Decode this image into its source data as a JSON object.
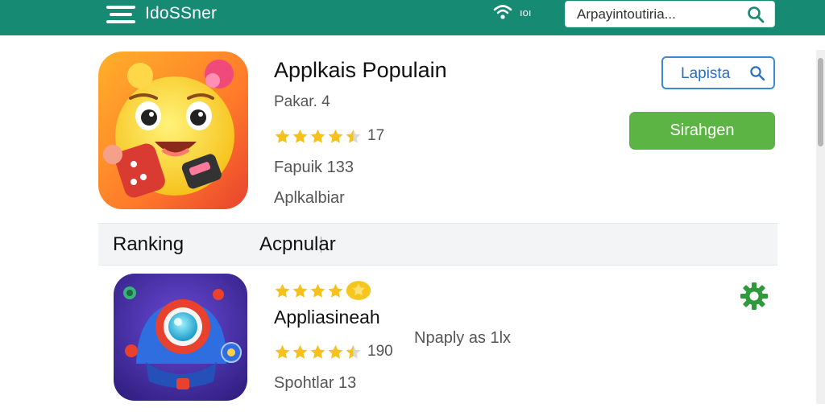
{
  "header": {
    "brand": "IdoSSner",
    "signal_text": "ıoı",
    "search_value": "Arpayintoutiria..."
  },
  "featured_app": {
    "title": "Applkais Populain",
    "subtitle": "Pakar. 4",
    "rating_stars": 4.5,
    "rating_count": "17",
    "meta_line_1": "Fapuik 133",
    "meta_line_2": "Aplkalbiar",
    "search_button_label": "Lapista",
    "install_button_label": "Sirahgen"
  },
  "tabs": [
    {
      "label": "Ranking"
    },
    {
      "label": "Acpnular"
    }
  ],
  "list_item": {
    "top_rating_stars": 5,
    "title": "Appliasineah",
    "rating_stars": 4.5,
    "rating_count": "190",
    "meta": "Spohtlar 13",
    "description": "Npaply as 1lx"
  },
  "colors": {
    "header_bg": "#178a74",
    "install_green": "#5bb443",
    "outline_blue": "#3a8ad6",
    "star_gold": "#f4c21a",
    "gear_green": "#2e9a3b"
  },
  "icons": {
    "menu": "menu-icon",
    "wifi": "wifi-icon",
    "search": "search-icon",
    "settings": "gear-icon"
  }
}
